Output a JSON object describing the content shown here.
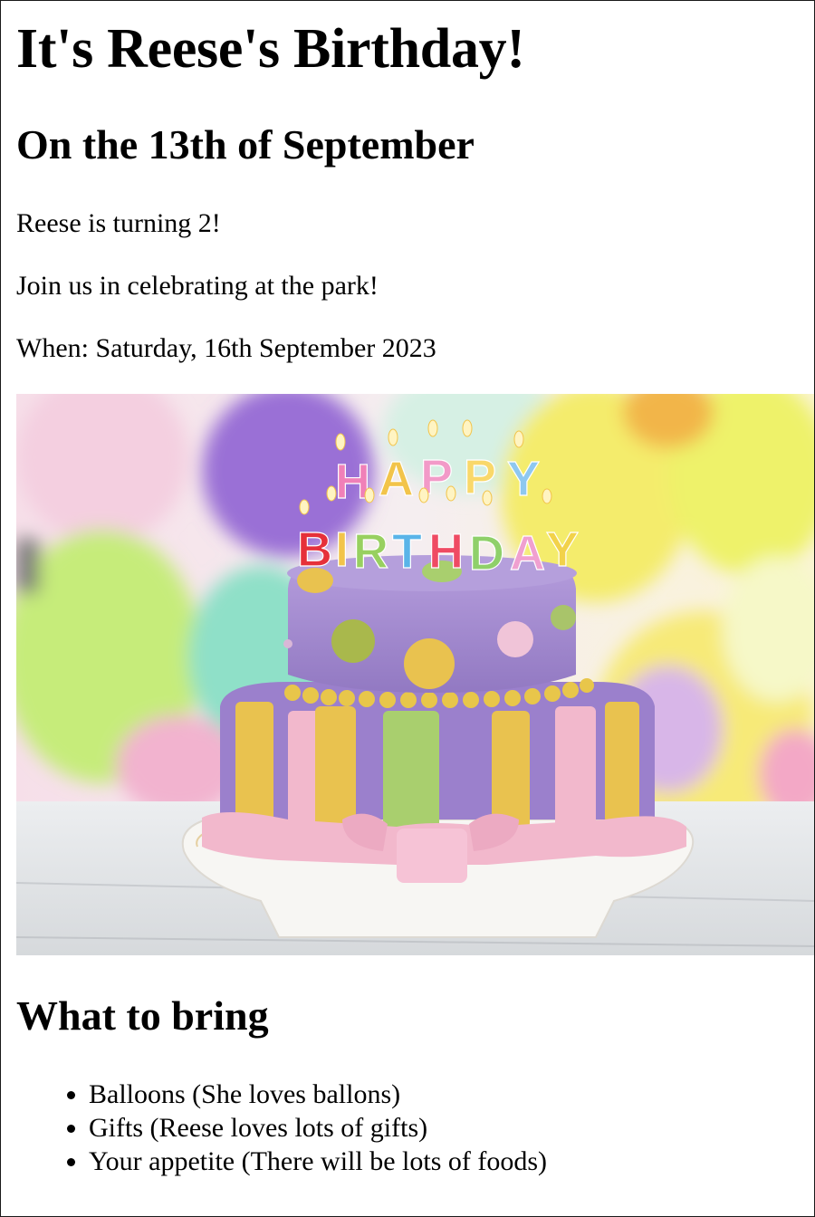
{
  "page": {
    "title": "It's Reese's Birthday!",
    "subtitle": "On the 13th of September",
    "paragraphs": [
      "Reese is turning 2!",
      "Join us in celebrating at the park!",
      "When: Saturday, 16th September 2023"
    ]
  },
  "image": {
    "description_icon": "birthday-cake-photo",
    "candle_letters": [
      "H",
      "A",
      "P",
      "P",
      "Y",
      "B",
      "I",
      "R",
      "T",
      "H",
      "D",
      "A",
      "Y"
    ],
    "colors": {
      "cake_purple": "#a68bd0",
      "stripe_yellow": "#e9c24f",
      "stripe_green": "#a9cf6e",
      "ribbon_pink": "#f2b8cc",
      "balloon_purple": "#9a6fd6",
      "balloon_yellow": "#eef26a",
      "balloon_green": "#c6ec7a"
    }
  },
  "bring": {
    "heading": "What to bring",
    "items": [
      "Balloons (She loves ballons)",
      "Gifts (Reese loves lots of gifts)",
      "Your appetite (There will be lots of foods)"
    ]
  }
}
